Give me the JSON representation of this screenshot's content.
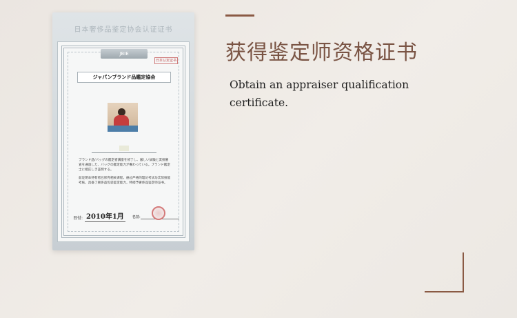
{
  "certificate": {
    "header_text": "日本奢侈品鉴定协会认证证书",
    "banner_text": "JBIE",
    "seal_tag_text": "日本认定证书",
    "title": "ジャパンブランド品鑑定協会",
    "body_jp": "ブランド品/バッグの鑑定者講座を修了し、厳しい試験と実技審査を通過した、バッグの鑑定能力が備わっている。ブランド鑑定士に相応しき証明する。",
    "body_cn": "兹证明本持有者已修完相关课程，通过严格的理论考试与实际技能考核，具备了奢侈品包袋鉴定能力，特授予奢侈品鉴定师证书。",
    "date_label": "日付:",
    "date_value": "2010年1月",
    "sign_label": "名前:"
  },
  "heading": {
    "zh": "获得鉴定师资格证书",
    "en": "Obtain an appraiser qualification certificate."
  },
  "colors": {
    "accent": "#8a5a44",
    "heading": "#7a5444",
    "body_text": "#1e1e1e",
    "background": "#ede9e4"
  }
}
